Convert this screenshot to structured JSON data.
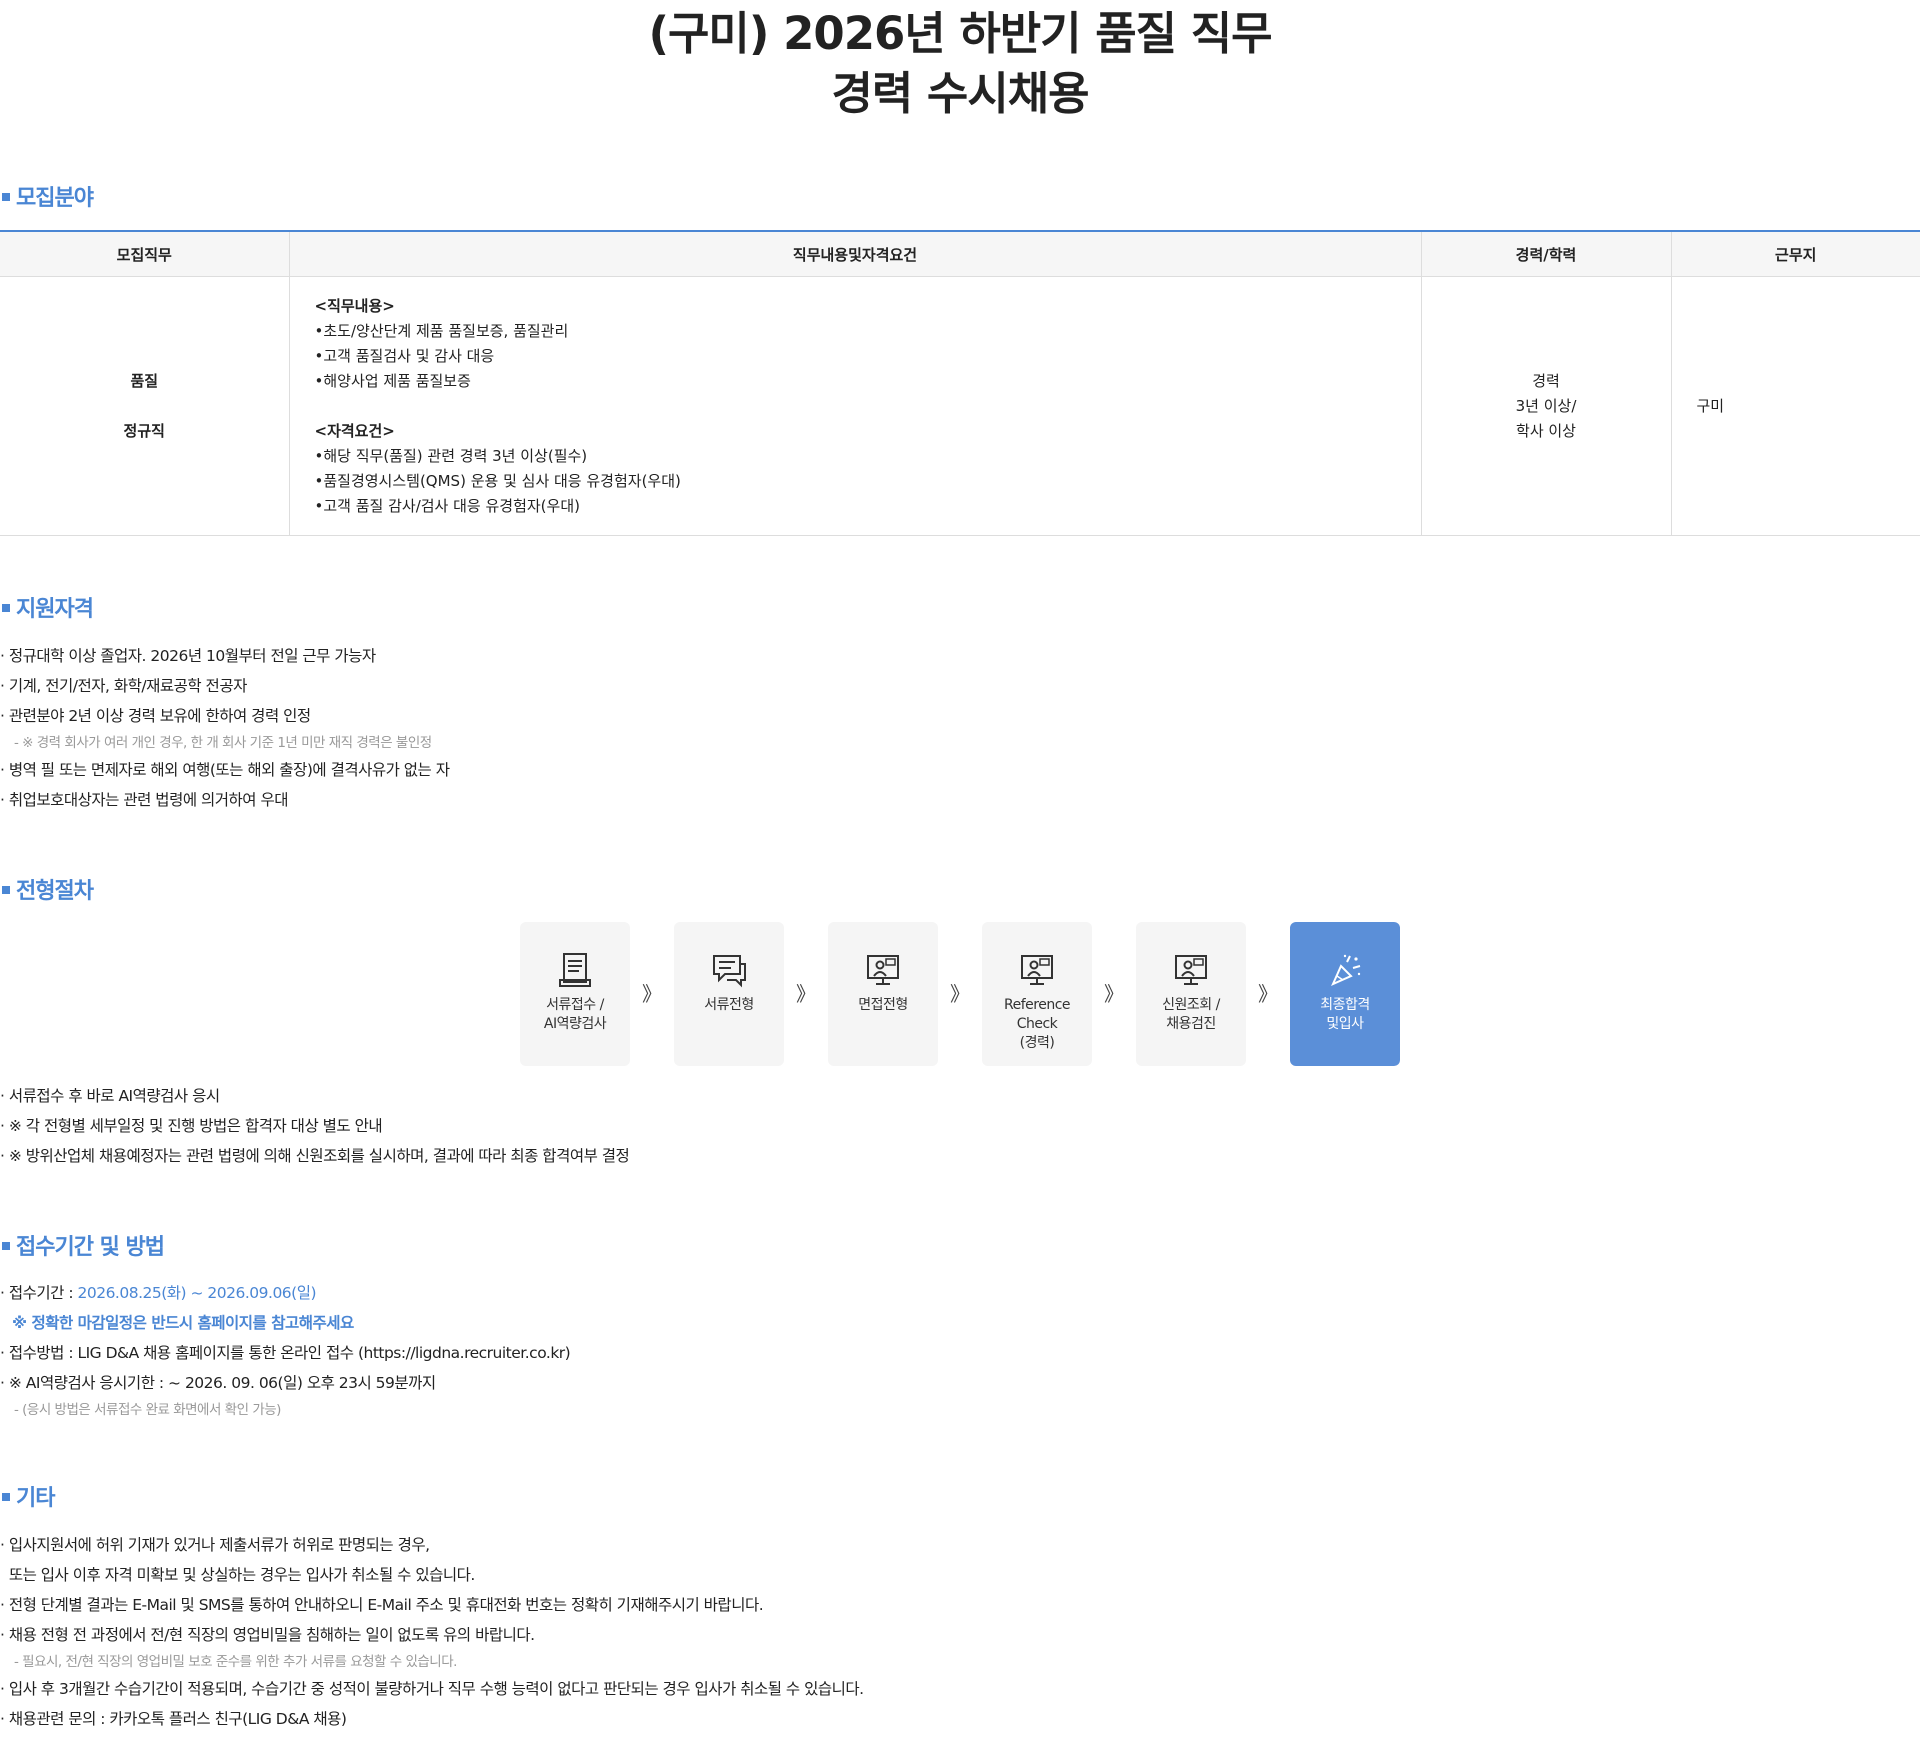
{
  "page_title": {
    "line1": "(구미) 2026년 하반기 품질 직무",
    "line2": "경력 수시채용"
  },
  "section_recruit": {
    "heading": "모집분야",
    "table": {
      "headers": [
        "모집직무",
        "직무내용및자격요건",
        "경력/학력",
        "근무지"
      ],
      "job": [
        "품질",
        "정규직"
      ],
      "duty_heading": "<직무내용>",
      "duties": [
        "초도/양산단계 제품 품질보증, 품질관리",
        "고객 품질검사 및 감사 대응",
        "해양사업 제품 품질보증"
      ],
      "req_heading": "<자격요건>",
      "requirements": [
        "해당 직무(품질) 관련 경력 3년 이상(필수)",
        "품질경영시스템(QMS) 운용 및 심사 대응 유경험자(우대)",
        "고객 품질 감사/검사 대응 유경험자(우대)"
      ],
      "career": [
        "경력",
        "3년 이상/",
        "학사 이상"
      ],
      "location": "구미"
    }
  },
  "section_qual": {
    "heading": "지원자격",
    "items": [
      "· 정규대학 이상 졸업자. 2026년 10월부터 전일 근무 가능자",
      "· 기계, 전기/전자, 화학/재료공학 전공자",
      "· 관련분야 2년 이상 경력 보유에 한하여 경력 인정"
    ],
    "note": "- ※ 경력 회사가 여러 개인 경우, 한 개 회사 기준 1년 미만 재직 경력은 불인정",
    "items2": [
      "· 병역 필 또는 면제자로 해외 여행(또는 해외 출장)에 결격사유가 없는 자",
      "· 취업보호대상자는 관련 법령에 의거하여 우대"
    ]
  },
  "section_process": {
    "heading": "전형절차",
    "steps": [
      {
        "label": "서류접수 / AI역량검사",
        "icon": "document-icon"
      },
      {
        "label": "서류전형",
        "icon": "chat-icon"
      },
      {
        "label": "면접전형",
        "icon": "monitor-person-icon"
      },
      {
        "label": "Reference Check (경력)",
        "icon": "monitor-person-icon"
      },
      {
        "label": "신원조회 / 채용검진",
        "icon": "monitor-person-icon"
      },
      {
        "label": "최종합격 및입사",
        "icon": "party-popper-icon"
      }
    ],
    "arrow": "》",
    "notes": [
      "· 서류접수 후 바로 AI역량검사 응시",
      "· ※ 각 전형별 세부일정 및 진행 방법은 합격자 대상 별도 안내",
      "· ※ 방위산업체 채용예정자는 관련 법령에 의해 신원조회를 실시하며, 결과에 따라 최종 합격여부 결정"
    ]
  },
  "section_period": {
    "heading": "접수기간 및 방법",
    "period_label": "· 접수기간 : ",
    "period_value": "2026.08.25(화) ~ 2026.09.06(일)",
    "period_note": "※ 정확한 마감일정은 반드시 홈페이지를 참고해주세요",
    "method": "· 접수방법 : LIG D&A 채용 홈페이지를 통한 온라인 접수 (https://ligdna.recruiter.co.kr)",
    "ai_deadline": "· ※ AI역량검사 응시기한 : ~ 2026. 09. 06(일) 오후 23시 59분까지",
    "ai_note": "- (응시 방법은 서류접수 완료 화면에서 확인 가능)"
  },
  "section_etc": {
    "heading": "기타",
    "items": [
      "· 입사지원서에 허위 기재가 있거나 제출서류가 허위로 판명되는 경우,",
      "  또는 입사 이후 자격 미확보 및 상실하는 경우는 입사가 취소될 수 있습니다.",
      "· 전형 단계별 결과는 E-Mail 및 SMS를 통하여 안내하오니 E-Mail 주소 및 휴대전화 번호는 정확히 기재해주시기 바랍니다.",
      "· 채용 전형 전 과정에서 전/현 직장의 영업비밀을 침해하는 일이 없도록 유의 바랍니다."
    ],
    "note": "- 필요시, 전/현 직장의 영업비밀 보호 준수를 위한 추가 서류를 요청할 수 있습니다.",
    "items2": [
      "· 입사 후 3개월간 수습기간이 적용되며, 수습기간 중 성적이 불량하거나 직무 수행 능력이 없다고 판단되는 경우 입사가 취소될 수 있습니다.",
      "· 채용관련 문의 : 카카오톡 플러스 친구(LIG D&A 채용)"
    ]
  },
  "colors": {
    "accent": "#4a86d4",
    "final_step": "#5b8fd8",
    "header_bg": "#f6f6f6",
    "muted": "#999999"
  }
}
